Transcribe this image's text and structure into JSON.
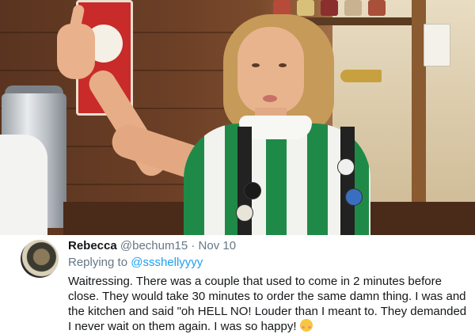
{
  "tweet": {
    "display_name": "Rebecca",
    "handle": "@bechum15",
    "separator": "·",
    "date": "Nov 10",
    "replying_prefix": "Replying to ",
    "replying_to": "@ssshellyyyy",
    "text": "Waitressing. There was a couple that used to come in 2 minutes before close. They would take 30 minutes to order the same damn thing. I was and the kitchen and said \"oh HELL NO! Louder than I meant to. They demanded I never wait on them again. I was so happy! ",
    "emoji_icon": "smiling-blushing-face-icon"
  },
  "photo": {
    "subject": "waitress-photo"
  },
  "colors": {
    "link": "#1da1f2",
    "meta": "#657786",
    "text": "#14171a",
    "shirt_green": "#1f8a48"
  }
}
